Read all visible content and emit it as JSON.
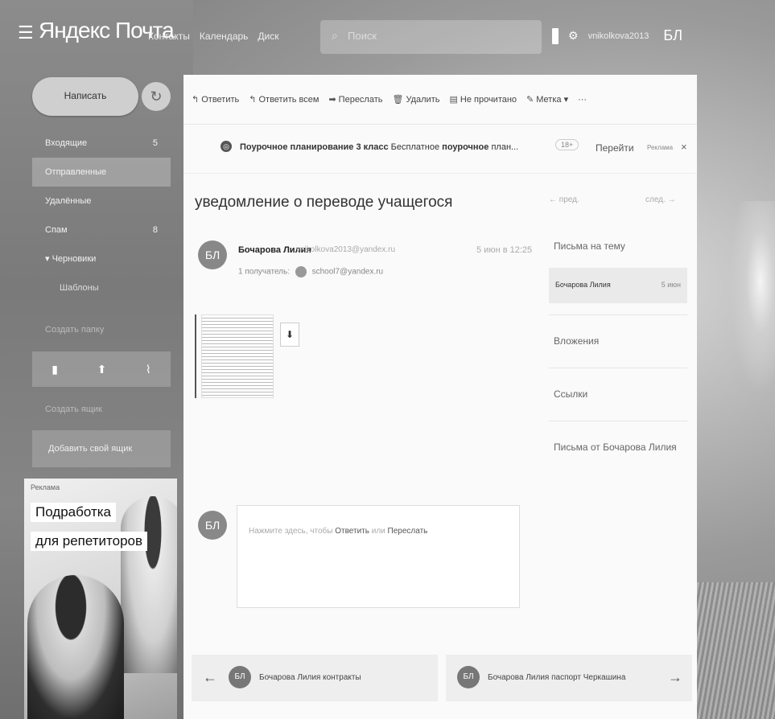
{
  "colors": {
    "sidebar_active": "#ffffff40",
    "panel_bg": "#fafafa"
  },
  "header": {
    "logo": "Яндекс Почта",
    "nav": [
      "Контакты",
      "Календарь",
      "Диск"
    ],
    "search_placeholder": "Поиск",
    "email": "vnikolkova2013",
    "initials": "БЛ"
  },
  "sidebar": {
    "write_label": "Написать",
    "folders": [
      {
        "label": "Входящие",
        "count": "5"
      },
      {
        "label": "Отправленные",
        "count": ""
      },
      {
        "label": "Удалённые",
        "count": ""
      },
      {
        "label": "Спам",
        "count": "8"
      },
      {
        "label": "▾ Черновики",
        "count": ""
      },
      {
        "label": "Шаблоны",
        "count": ""
      }
    ],
    "create_folder": "Создать папку",
    "create_mailbox": "Создать ящик",
    "add_mail": "Добавить свой ящик"
  },
  "ad": {
    "label": "Реклама",
    "title_line1": "Подработка",
    "title_line2": "для репетиторов"
  },
  "toolbar": {
    "reply": "Ответить",
    "reply_all": "Ответить всем",
    "forward": "Переслать",
    "delete": "Удалить",
    "unread": "Не прочитано",
    "label": "Метка ▾",
    "more": "···"
  },
  "promo": {
    "title": "Поурочное планирование 3 класс",
    "text_before": "Бесплатное",
    "bold_word": "поурочное",
    "text_after": "план...",
    "age": "18+",
    "go": "Перейти",
    "ad": "Реклама",
    "close": "×"
  },
  "message": {
    "subject": "уведомление о переводе учащегося",
    "avatar": "БЛ",
    "sender": "Бочарова Лилия",
    "sender_email": "vnikolkova2013@yandex.ru",
    "recipients_label": "1 получатель:",
    "recipient": "sсhool7@yandex.ru",
    "date": "5 июн в 12:25"
  },
  "side": {
    "prev": "← пред.",
    "next": "след. →",
    "thread_title": "Письма на тему",
    "thread_item": "Бочарова Лилия",
    "thread_date": "5 июн",
    "attachments": "Вложения",
    "links": "Ссылки",
    "from_sender": "Письма от Бочарова Лилия"
  },
  "reply": {
    "avatar": "БЛ",
    "ph_before": "Нажмите здесь, чтобы",
    "ph_reply": "Ответить",
    "ph_or": "или",
    "ph_forward": "Переслать"
  },
  "bottom": {
    "prev_avatar": "БЛ",
    "prev_label": "Бочарова Лилия   контракты",
    "next_avatar": "БЛ",
    "next_label": "Бочарова Лилия   паспорт Черкашина"
  }
}
